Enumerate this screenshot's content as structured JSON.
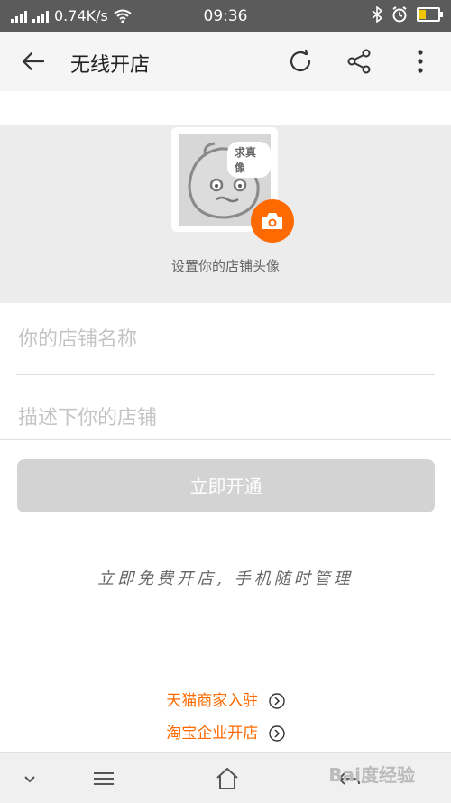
{
  "status_bar": {
    "network_speed": "0.74K/s",
    "time": "09:36"
  },
  "app_bar": {
    "title": "无线开店",
    "icons": [
      "back-arrow-icon",
      "refresh-icon",
      "share-icon",
      "more-vert-icon"
    ]
  },
  "avatar": {
    "bubble_text": "求真像",
    "caption": "设置你的店铺头像",
    "accent_color": "#ff6a00"
  },
  "form": {
    "shop_name_placeholder": "你的店铺名称",
    "shop_desc_placeholder": "描述下你的店铺",
    "submit_label": "立即开通"
  },
  "slogan": "立即免费开店, 手机随时管理",
  "links": [
    {
      "label": "天猫商家入驻"
    },
    {
      "label": "淘宝企业开店"
    }
  ],
  "nav_bar": {
    "watermark": "Bai度经验"
  }
}
